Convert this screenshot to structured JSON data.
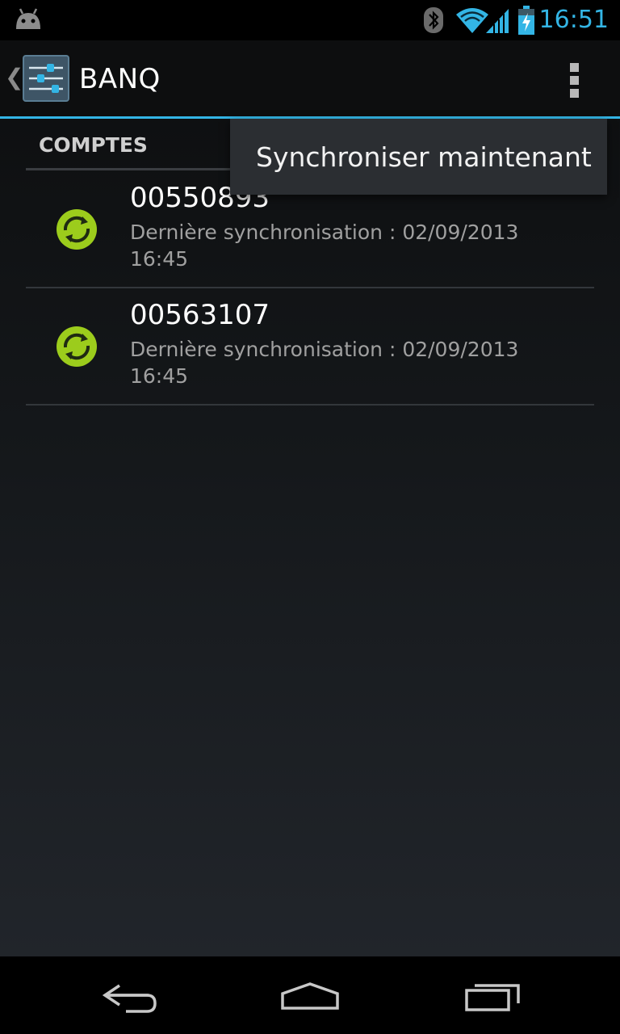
{
  "status_bar": {
    "time": "16:51",
    "icons": [
      "android-icon",
      "bluetooth-icon",
      "wifi-icon",
      "signal-icon",
      "battery-charging-icon"
    ],
    "accent": "#33b5e5"
  },
  "action_bar": {
    "title": "BANQ",
    "app_icon": "settings-sliders-icon",
    "overflow_icon": "overflow-menu-icon"
  },
  "section": {
    "header": "COMPTES"
  },
  "accounts": [
    {
      "number": "00550893",
      "sync_label": "Dernière synchronisation : 02/09/2013 16:45"
    },
    {
      "number": "00563107",
      "sync_label": "Dernière synchronisation : 02/09/2013 16:45"
    }
  ],
  "popup_menu": {
    "items": [
      {
        "label": "Synchroniser maintenant"
      }
    ]
  },
  "nav_bar": {
    "buttons": [
      "back-icon",
      "home-icon",
      "recent-apps-icon"
    ]
  },
  "colors": {
    "accent": "#33b5e5",
    "sync_green": "#9ccc1c"
  }
}
